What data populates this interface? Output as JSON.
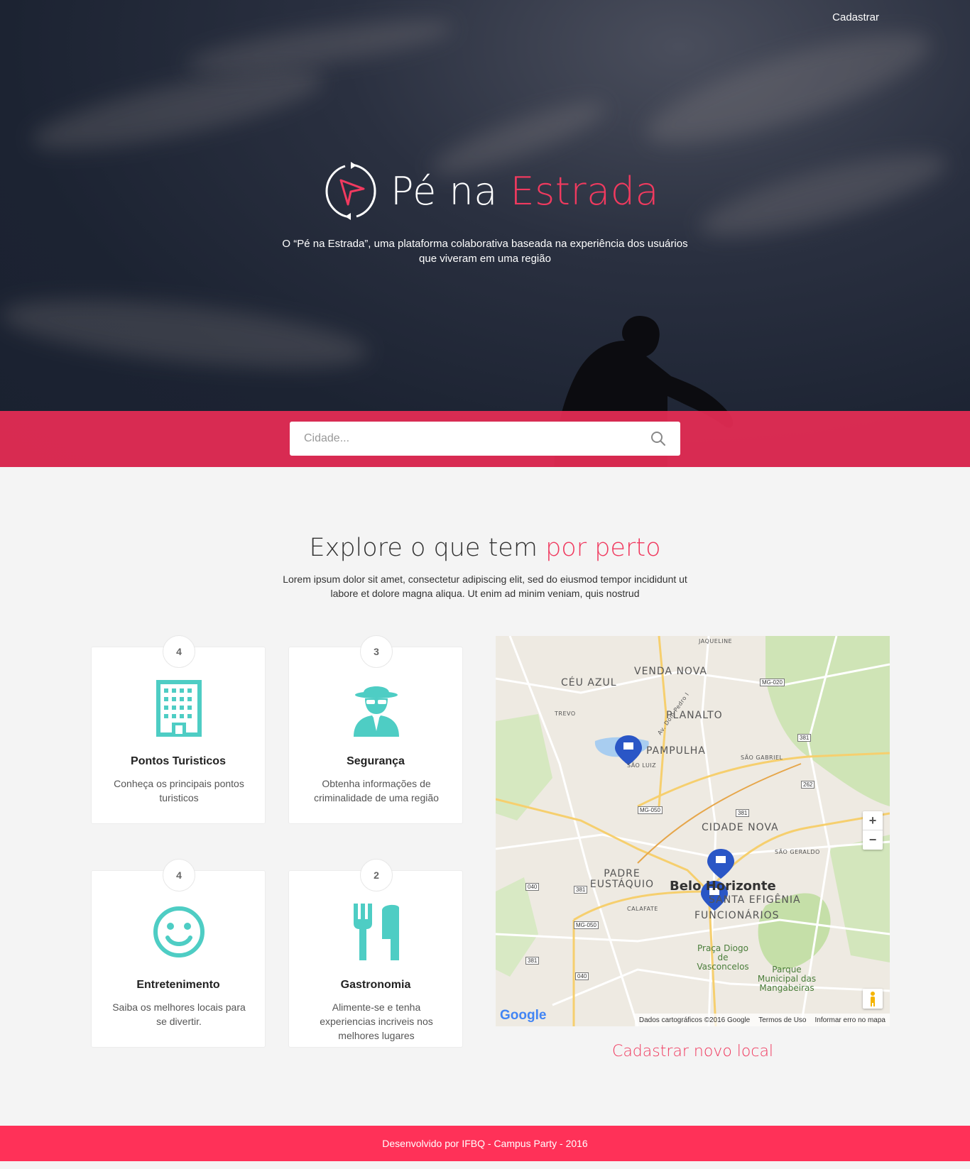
{
  "nav": {
    "register_label": "Cadastrar"
  },
  "hero": {
    "brand_part1": "Pé na ",
    "brand_part2": "Estrada",
    "description": "O “Pé na Estrada”, uma plataforma colaborativa baseada na experiência dos usuários que viveram em uma região"
  },
  "search": {
    "placeholder": "Cidade..."
  },
  "explore": {
    "title_part1": "Explore o que tem ",
    "title_part2": "por perto",
    "description": "Lorem ipsum dolor sit amet, consectetur adipiscing elit, sed do eiusmod tempor incididunt ut labore et dolore magna aliqua. Ut enim ad minim veniam, quis nostrud"
  },
  "cards": [
    {
      "count": "4",
      "title": "Pontos Turisticos",
      "description": "Conheça os principais pontos turisticos",
      "icon": "building-icon"
    },
    {
      "count": "3",
      "title": "Segurança",
      "description": "Obtenha informações de criminalidade de uma região",
      "icon": "spy-icon"
    },
    {
      "count": "4",
      "title": "Entretenimento",
      "description": "Saiba os melhores locais para se divertir.",
      "icon": "smiley-icon"
    },
    {
      "count": "2",
      "title": "Gastronomia",
      "description": "Alimente-se e tenha experiencias incriveis nos melhores lugares",
      "icon": "cutlery-icon"
    }
  ],
  "map": {
    "labels": {
      "jaqueline": "JAQUELINE",
      "venda_nova": "VENDA NOVA",
      "ceu_azul": "CÉU AZUL",
      "trevo": "TREVO",
      "planalto": "PLANALTO",
      "pampulha": "PAMPULHA",
      "sao_luiz": "SÃO LUIZ",
      "sao_gabriel": "SÃO GABRIEL",
      "cidade_nova": "CIDADE NOVA",
      "sao_geraldo": "SÃO GERALDO",
      "padre_eustaquio": "PADRE EUSTÁQUIO",
      "belo_horizonte": "Belo Horizonte",
      "santa_efigenia": "SANTA EFIGÊNIA",
      "funcionarios": "FUNCIONÁRIOS",
      "calafate": "CALAFATE",
      "praca": "Praça Diogo de Vasconcelos",
      "parque": "Parque Municipal das Mangabeiras",
      "av_dom_pedro": "Av. Dom Pedro I"
    },
    "road_shields": [
      "MG-020",
      "381",
      "262",
      "MG-050",
      "381",
      "040",
      "381",
      "MG-050",
      "381",
      "040"
    ],
    "zoom_in": "+",
    "zoom_out": "−",
    "google_logo": "Google",
    "attribution": "Dados cartográficos ©2016 Google",
    "terms": "Termos de Uso",
    "report": "Informar erro no mapa"
  },
  "add_location_label": "Cadastrar novo local",
  "footer": {
    "text": "Desenvolvido por IFBQ - Campus Party - 2016"
  },
  "colors": {
    "accent": "#f03a5f",
    "teal": "#4ecdc4",
    "footer": "#ff3158"
  }
}
